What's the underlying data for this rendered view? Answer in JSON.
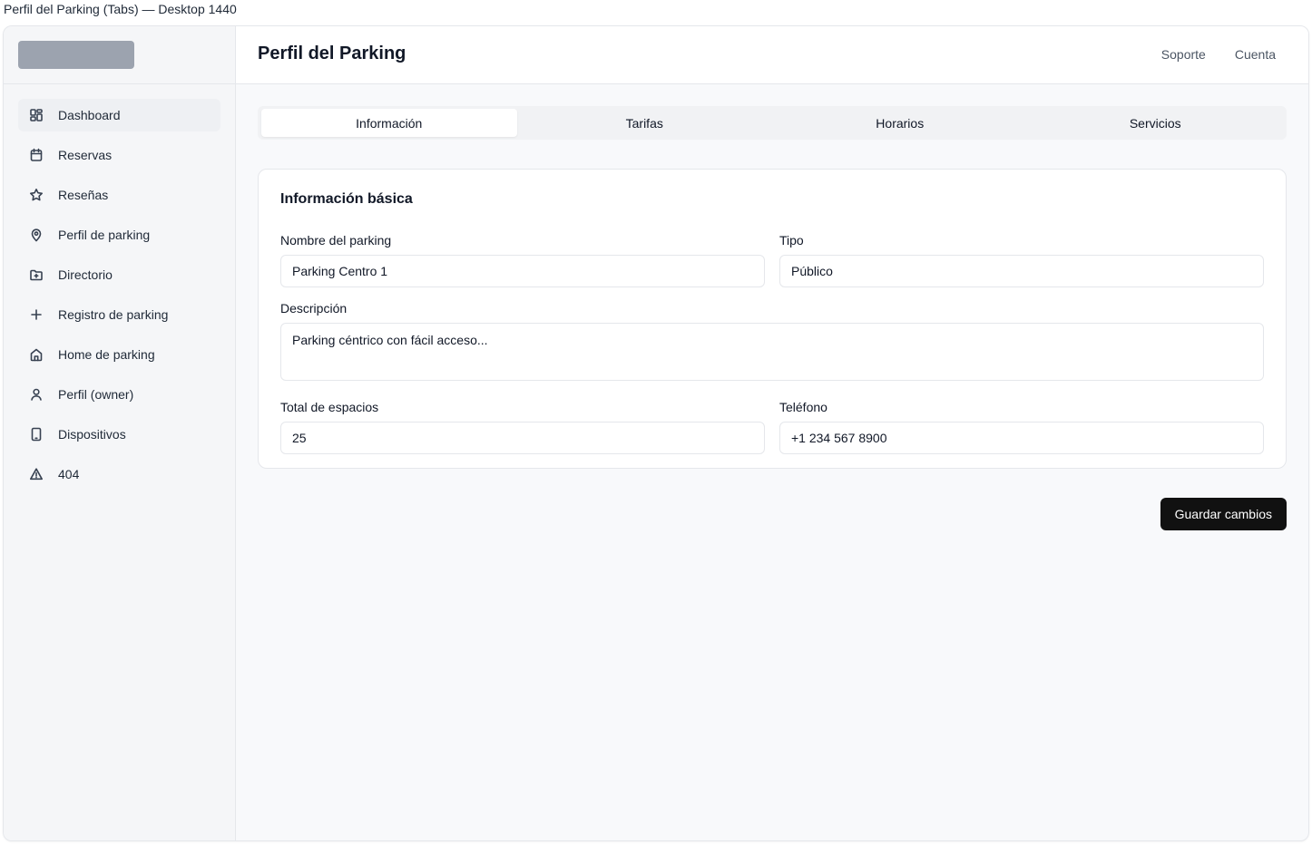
{
  "frame_label": "Perfil del Parking (Tabs) — Desktop 1440",
  "sidebar": {
    "items": [
      {
        "label": "Dashboard",
        "icon": "dashboard-icon"
      },
      {
        "label": "Reservas",
        "icon": "calendar-icon"
      },
      {
        "label": "Reseñas",
        "icon": "star-icon"
      },
      {
        "label": "Perfil de parking",
        "icon": "map-pin-icon"
      },
      {
        "label": "Directorio",
        "icon": "folder-icon"
      },
      {
        "label": "Registro de parking",
        "icon": "plus-icon"
      },
      {
        "label": "Home de parking",
        "icon": "home-icon"
      },
      {
        "label": "Perfil (owner)",
        "icon": "user-icon"
      },
      {
        "label": "Dispositivos",
        "icon": "device-icon"
      },
      {
        "label": "404",
        "icon": "alert-triangle-icon"
      }
    ],
    "active_index": 0
  },
  "header": {
    "title": "Perfil del Parking",
    "links": [
      "Soporte",
      "Cuenta"
    ]
  },
  "tabs": {
    "items": [
      "Información",
      "Tarifas",
      "Horarios",
      "Servicios"
    ],
    "active_index": 0
  },
  "form": {
    "title": "Información básica",
    "nombre_label": "Nombre del parking",
    "nombre_value": "Parking Centro 1",
    "tipo_label": "Tipo",
    "tipo_value": "Público",
    "descripcion_label": "Descripción",
    "descripcion_value": "Parking céntrico con fácil acceso...",
    "espacios_label": "Total de espacios",
    "espacios_value": "25",
    "telefono_label": "Teléfono",
    "telefono_value": "+1 234 567 8900"
  },
  "save_label": "Guardar cambios",
  "colors": {
    "primary_button": "#111111",
    "sidebar_bg": "#f5f6f8",
    "logo_placeholder": "#9ca3af"
  }
}
